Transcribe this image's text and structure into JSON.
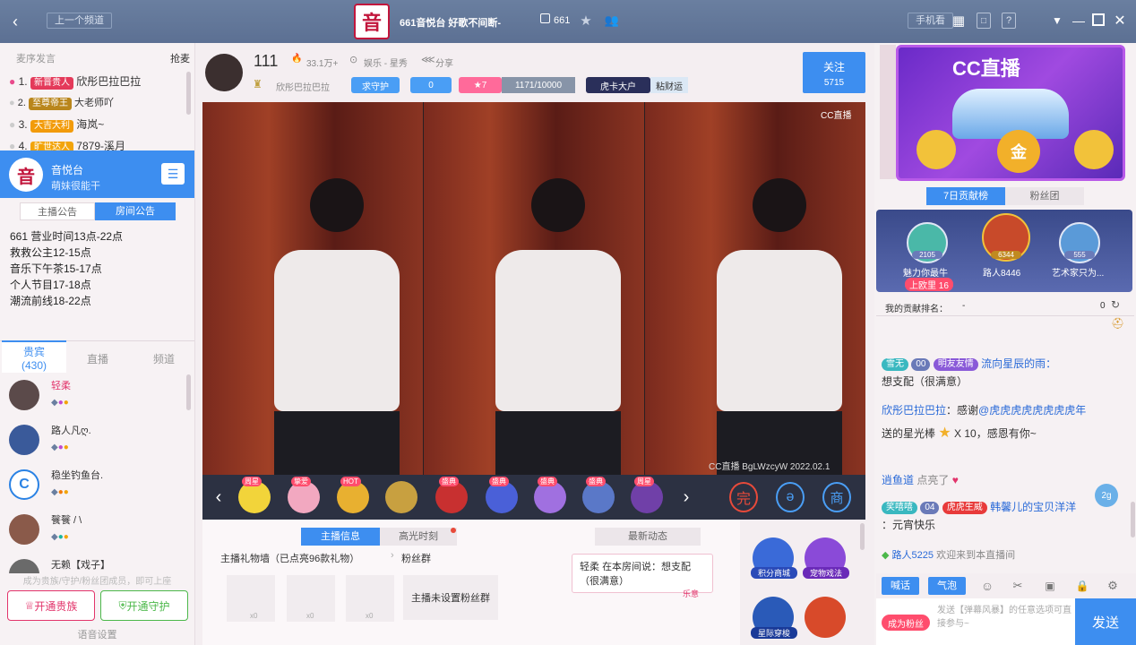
{
  "topbar": {
    "prev_channel": "上一个频道",
    "room_title": "661音悦台 好歌不间断-",
    "room_id": "661",
    "phone_watch": "手机看"
  },
  "left": {
    "rank_header": "麦序发言",
    "grab_mic": "抢麦",
    "rank": [
      {
        "n": "1.",
        "tag": "新晋贵人",
        "name": "欣彤巴拉巴拉"
      },
      {
        "n": "2.",
        "tag": "至尊帝王",
        "name": "大老师吖"
      },
      {
        "n": "3.",
        "tag": "大吉大利",
        "name": "海岚~"
      },
      {
        "n": "4.",
        "tag": "旷世达人",
        "name": "7879-溪月"
      }
    ],
    "channel_name": "音悦台",
    "channel_sub": "萌妹很能干",
    "notice_tabs": [
      "主播公告",
      "房间公告"
    ],
    "notice_lines": [
      "661 营业时间13点-22点",
      "救救公主12-15点",
      "音乐下午茶15-17点",
      "个人节目17-18点",
      "潮流前线18-22点"
    ],
    "member_tabs": [
      "贵宾",
      "直播",
      "频道"
    ],
    "member_count": "(430)",
    "members": [
      "轻柔",
      "路人凡ღ.",
      "稳坐钓鱼台.",
      "餮餮 / \\",
      "无赖【戏子】"
    ],
    "member_hint": "成为贵族/守护/粉丝团成员，即可上座",
    "btn_noble": "开通贵族",
    "btn_guard": "开通守护",
    "voice_settings": "语音设置"
  },
  "mid": {
    "anchor_id": "111",
    "heat": "33.1万+",
    "category": "娱乐 - 星秀",
    "share": "分享",
    "anchor_name": "欣彤巴拉巴拉",
    "guard": "求守护",
    "fans": "0",
    "level": "7",
    "exp": "1171/10000",
    "tag1": "虎卡大户",
    "tag2": "粘财运",
    "follow": "关注",
    "follow_count": "5715",
    "video_logo": "CC直播",
    "watermark": "CC直播 BgLWzcyW 2022.02.1",
    "gift_tags": [
      "周星",
      "挚爱",
      "HOT",
      "",
      "盛典",
      "盛典",
      "盛典",
      "盛典",
      "周星"
    ],
    "info_tabs": [
      "主播信息",
      "高光时刻"
    ],
    "news_tab": "最新动态",
    "gift_wall": "主播礼物墙（已点亮96款礼物）",
    "fan_group": "粉丝群",
    "gift_counts": [
      "x0",
      "x0",
      "x0"
    ],
    "fan_group_none": "主播未设置粉丝群",
    "message_card": {
      "user": "轻柔",
      "text": "在本房间说：想支配（很满意）",
      "sig": "乐意"
    },
    "side_items": [
      "积分商城",
      "宠物戏法",
      "星际穿梭"
    ]
  },
  "right": {
    "banner_text": "CC直播",
    "contrib_tabs": [
      "7日贡献榜",
      "粉丝团"
    ],
    "podium": [
      {
        "val": "2105",
        "name": "魅力你最牛"
      },
      {
        "val": "6344",
        "name": "路人8446"
      },
      {
        "val": "555",
        "name": "艺术家只为..."
      }
    ],
    "on_list": "上欧里",
    "on_list_num": "16",
    "my_rank_label": "我的贡献排名：",
    "my_rank": "-",
    "my_rank_right": "0",
    "chat": [
      {
        "user": "雪无",
        "lv": "00",
        "badge": "明友友情",
        "name": "流向星辰的雨：",
        "text": "想支配（很满意）"
      },
      {
        "user": "欣彤巴拉巴拉",
        "text": "：感谢",
        "mention": "@虎虎虎虎虎虎虎虎年",
        "tail": "送的星光棒",
        "count": "X 10，感恩有你~"
      },
      {
        "user": "逍鱼道",
        "text": "点亮了"
      },
      {
        "user": "笑嘻嘻",
        "lv": "04",
        "badge": "虎虎生威",
        "name": "韩馨儿的宝贝洋洋",
        "text": "：元宵快乐"
      },
      {
        "user": "路人5225",
        "text": "欢迎来到本直播间"
      }
    ],
    "tools": [
      "喊话",
      "气泡"
    ],
    "become_fan": "成为粉丝",
    "input_placeholder": "发送【弹幕风暴】的任意选项可直接参与~",
    "send": "发送"
  },
  "colors": {
    "accent": "#3d8ef0",
    "topbar": "#6a7fa0",
    "pink": "#ff4d6d"
  }
}
